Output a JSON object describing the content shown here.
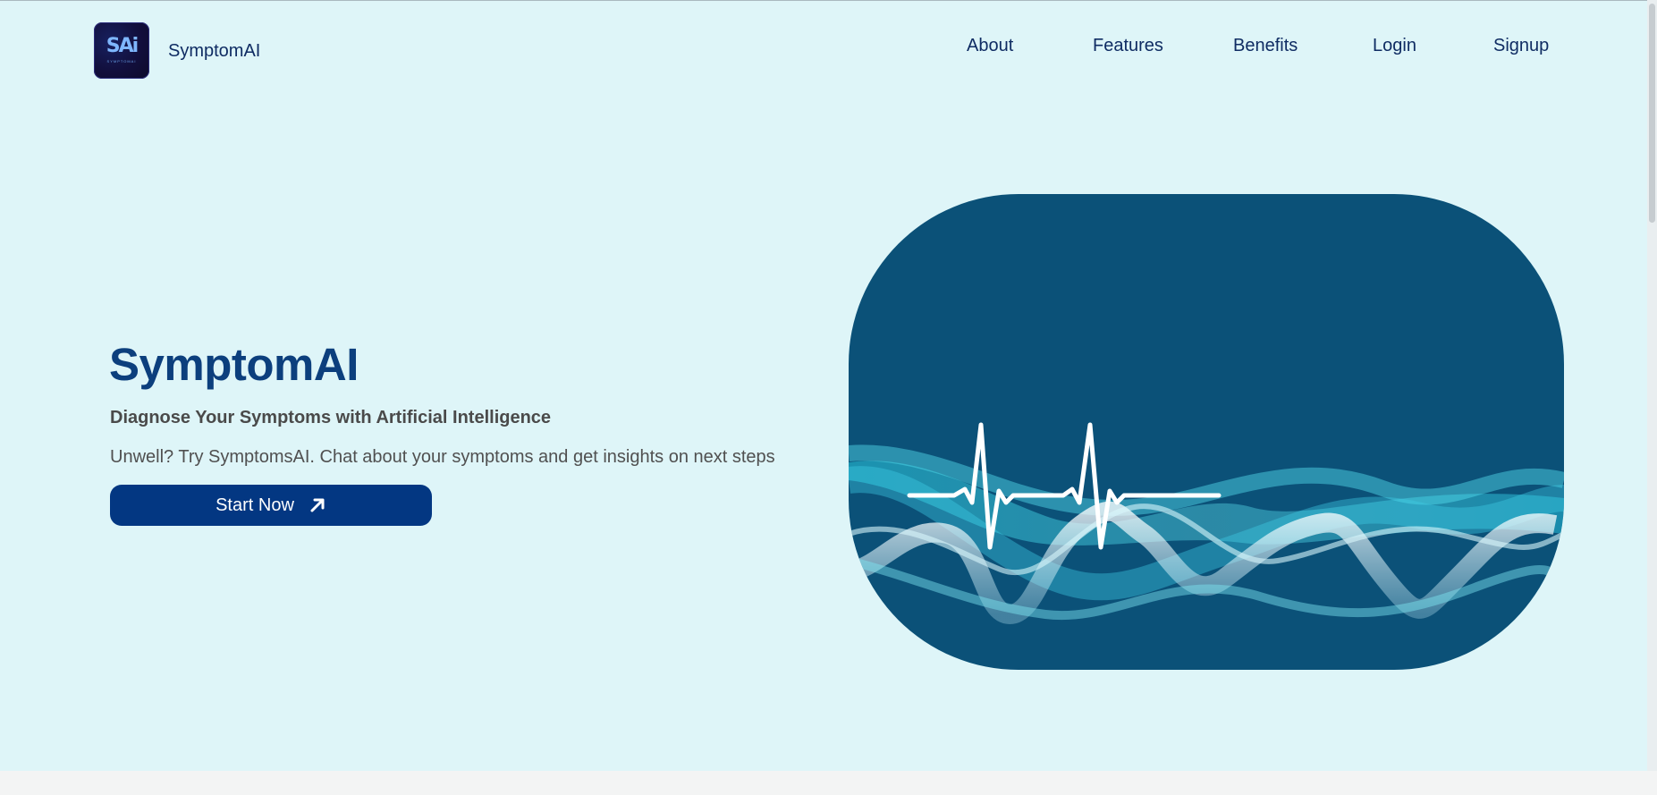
{
  "header": {
    "logo_text": "SAi",
    "logo_subtext": "SYMPTOMAI",
    "brand_name": "SymptomAI",
    "nav": {
      "about": "About",
      "features": "Features",
      "benefits": "Benefits",
      "login": "Login",
      "signup": "Signup"
    }
  },
  "hero": {
    "title": "SymptomAI",
    "subtitle": "Diagnose Your Symptoms with Artificial Intelligence",
    "description": "Unwell? Try SymptomsAI. Chat about your symptoms and get insights on next steps",
    "cta_label": "Start Now",
    "cta_icon": "arrow-up-right-icon",
    "image_description_icon": "heartbeat-wave-illustration"
  },
  "colors": {
    "hero_background": "#def5f8",
    "footer_strip": "#f3f4f4",
    "title": "#0c3f7d",
    "cta_background": "#033782",
    "image_background": "#0b5178",
    "wave_cyan": "#3fd1e6",
    "nav_text": "#0f2c63"
  }
}
